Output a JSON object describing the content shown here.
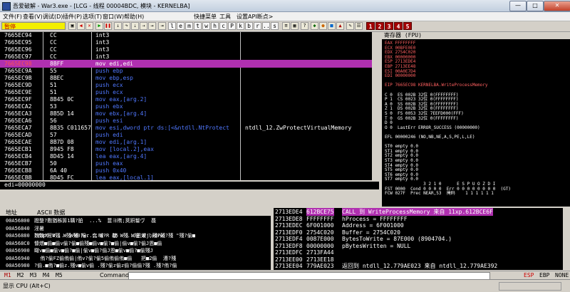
{
  "window": {
    "title": "吾爱破解 - War3.exe - [LCG - 线程 00004BDC, 模块 - KERNELBA]",
    "minimize": "—",
    "maximize": "□",
    "close": "✕"
  },
  "menu": [
    "文件(F)",
    "查看(V)",
    "调试(D)",
    "插件(P)",
    "选项(T)",
    "窗口(W)",
    "帮助(H)",
    "快捷菜单",
    "工具",
    "设置API断点>"
  ],
  "toolbar": {
    "status": "暂停",
    "letters": [
      "l",
      "e",
      "m",
      "t",
      "w",
      "h",
      "c",
      "P",
      "k",
      "b",
      "r",
      "...",
      "s"
    ],
    "numbers": [
      "1",
      "2",
      "3",
      "4",
      "5"
    ]
  },
  "cpu": {
    "rows": [
      {
        "addr": "7665EC94",
        "hex": "CC",
        "ins": "int3",
        "cmt": ""
      },
      {
        "addr": "7665EC95",
        "hex": "CC",
        "ins": "int3",
        "cmt": ""
      },
      {
        "addr": "7665EC96",
        "hex": "CC",
        "ins": "int3",
        "cmt": ""
      },
      {
        "addr": "7665EC97",
        "hex": "CC",
        "ins": "int3",
        "cmt": ""
      },
      {
        "addr": "7665EC98",
        "hex": "8BFF",
        "ins": "mov edi,edi",
        "cmt": ""
      },
      {
        "addr": "7665EC9A",
        "hex": "55",
        "ins": "push ebp",
        "cmt": ""
      },
      {
        "addr": "7665EC9B",
        "hex": "8BEC",
        "ins": "mov ebp,esp",
        "cmt": ""
      },
      {
        "addr": "7665EC9D",
        "hex": "51",
        "ins": "push ecx",
        "cmt": ""
      },
      {
        "addr": "7665EC9E",
        "hex": "51",
        "ins": "push ecx",
        "cmt": ""
      },
      {
        "addr": "7665EC9F",
        "hex": "8B45 0C",
        "ins": "mov eax,[arg.2]",
        "cmt": ""
      },
      {
        "addr": "7665ECA2",
        "hex": "53",
        "ins": "push ebx",
        "cmt": ""
      },
      {
        "addr": "7665ECA3",
        "hex": "8B5D 14",
        "ins": "mov ebx,[arg.4]",
        "cmt": ""
      },
      {
        "addr": "7665ECA6",
        "hex": "56",
        "ins": "push esi",
        "cmt": ""
      },
      {
        "addr": "7665ECA7",
        "hex": "8B35 C011657",
        "ins": "mov esi,dword ptr ds:[<&ntdll.NtProtect",
        "cmt": "ntdll_12.ZwProtectVirtualMemory"
      },
      {
        "addr": "7665ECAD",
        "hex": "57",
        "ins": "push edi",
        "cmt": ""
      },
      {
        "addr": "7665ECAE",
        "hex": "8B7D 08",
        "ins": "mov edi,[arg.1]",
        "cmt": ""
      },
      {
        "addr": "7665ECB1",
        "hex": "8945 F8",
        "ins": "mov [local.2],eax",
        "cmt": ""
      },
      {
        "addr": "7665ECB4",
        "hex": "8D45 14",
        "ins": "lea eax,[arg.4]",
        "cmt": ""
      },
      {
        "addr": "7665ECB7",
        "hex": "50",
        "ins": "push eax",
        "cmt": ""
      },
      {
        "addr": "7665ECB8",
        "hex": "6A 40",
        "ins": "push 0x40",
        "cmt": ""
      },
      {
        "addr": "7665ECBB",
        "hex": "8D45 FC",
        "ins": "lea eax,[local.1]",
        "cmt": ""
      }
    ],
    "info": "edi=00000000"
  },
  "registers": {
    "title": "寄存器 (FPU)",
    "lines": [
      "EAX FFFFFFFF",
      "ECX 00BFE0E0",
      "EDX 2754C020",
      "EBX 00000000",
      "ESP 2713EDE4",
      "EBP 2713EE48",
      "ESI 00A0E7D4",
      "EDI 00000000",
      "",
      "EIP 7665EC98 KERNELBA.WriteProcessMemory",
      "",
      "C 0  ES 002B 32位 0(FFFFFFFF)",
      "P 1  CS 0023 32位 0(FFFFFFFF)",
      "A 0  SS 002B 32位 0(FFFFFFFF)",
      "Z 1  DS 002B 32位 0(FFFFFFFF)",
      "S 0  FS 0053 32位 7EEFD000(FFF)",
      "T 0  GS 002B 32位 0(FFFFFFFF)",
      "D 0",
      "O 0  LastErr ERROR_SUCCESS (00000000)",
      "",
      "EFL 00000246 (NO,NB,NE,A,S,PE,L,LE)",
      "",
      "ST0 empty 0.0",
      "ST1 empty 0.0",
      "ST2 empty 0.0",
      "ST3 empty 0.0",
      "ST4 empty 0.0",
      "ST5 empty 0.0",
      "ST6 empty 0.0",
      "ST7 empty 0.0",
      "               3 2 1 0      E S P U O Z D I",
      "FST 0000  Cond 0 0 0 0  Err 0 0 0 0 0 0 0 0  (GT)",
      "FCW 027F  Prec NEAR,53  掩码    1 1 1 1 1 1"
    ]
  },
  "dump": {
    "headers": [
      "地址",
      "ASCII 数据"
    ],
    "rows": [
      {
        "addr": "00A56800",
        "txt": "蹬整?敷猶秭箅1鞲?胉  ...%  薏ヨ檇;莢趼鬘ヴ  薎"
      },
      {
        "addr": "00A56840",
        "txt": "淫暑\n魏魏?淫?...  W殘 陥r 奃 W-R 駛 W殘 W陥 W ?ud?w"
      },
      {
        "addr": "00A56880",
        "txt": "!?up0 W殘 W殘 W0?w....喊?  @5   ...恩煨j,殘F殘?殘 \"殘?偷■"
      },
      {
        "addr": "00A568C0",
        "txt": "慷煨■偷■偷v偷?偷■偷殘■偷v■偷?■偷|偷v■偷?偷J恩■偷"
      },
      {
        "addr": "00A56900",
        "txt": "瞰v■偷■偷v■偷?■偷|偷v■偷?偷J恩■偷v■偷?■偷殘J"
      },
      {
        "addr": "00A56940",
        "txt": "  侑?偷FZ偷侑偷|侑v?偷?偷5偷侑偷侑■偷   把■2偷  漕?殘"
      },
      {
        "addr": "00A56980",
        "txt": "?偷.■侑?■偷z.殘v■偷v偷 .殘?偷z偷z偷?偷偷?殘 .殘?侑?偷"
      }
    ]
  },
  "stack": {
    "rows": [
      {
        "addr": "2713EDE4",
        "val": "612BCE75",
        "com": "CALL 到 WriteProcessMemory 来自 11xp.612BCE6F"
      },
      {
        "addr": "2713EDE8",
        "val": "FFFFFFFF",
        "com": "hProcess = FFFFFFFF"
      },
      {
        "addr": "2713EDEC",
        "val": "6F001000",
        "com": "Address = 6F001000"
      },
      {
        "addr": "2713EDF0",
        "val": "2754C020",
        "com": "Buffer = 2754C020"
      },
      {
        "addr": "2713EDF4",
        "val": "0087E000",
        "com": "BytesToWrite = 87E000 (8904704.)"
      },
      {
        "addr": "2713EDF8",
        "val": "00000000",
        "com": "pBytesWritten = NULL"
      },
      {
        "addr": "2713EDFC",
        "val": "2713FA44",
        "com": ""
      },
      {
        "addr": "2713EE00",
        "val": "2713EE18",
        "com": ""
      },
      {
        "addr": "2713EE04",
        "val": "779AE023",
        "com": "返回到 ntdll_12.779AE023 来自 ntdll_12.779AE392"
      }
    ]
  },
  "cmdbar": {
    "tabs": [
      "M1",
      "M2",
      "M3",
      "M4",
      "M5"
    ],
    "label": "Command:",
    "right": [
      "ESP",
      "EBP",
      "NONE"
    ]
  },
  "statusbar": {
    "text": "显示 CPU (Alt+C)"
  },
  "colors": {
    "highlight": "#b030b0",
    "address_red": "#ff3030",
    "keyword_blue": "#3060ff",
    "cyan": "#00c8c8"
  }
}
